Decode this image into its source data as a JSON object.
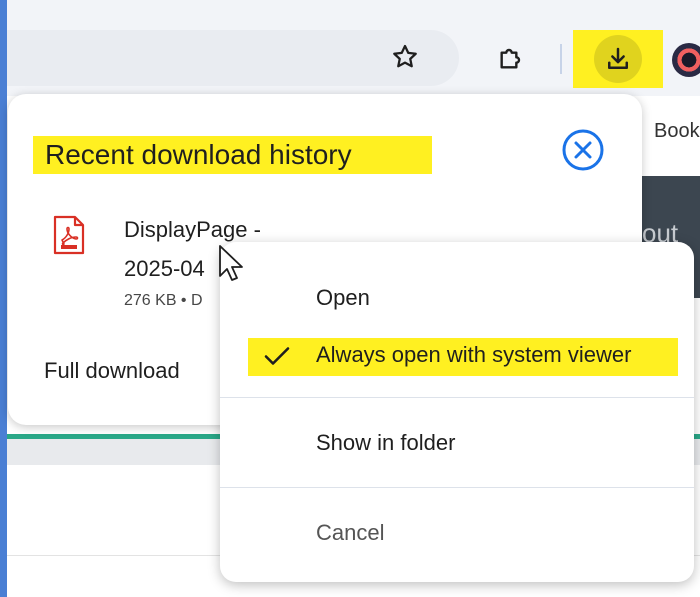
{
  "toolbar": {
    "bookmark_icon": "star-icon",
    "extensions_icon": "puzzle-icon",
    "downloads_icon": "download-icon",
    "profile_icon": "avatar"
  },
  "background_page": {
    "bookmarks_fragment": "Book",
    "dark_banner_fragment": "out"
  },
  "downloads_bubble": {
    "title": "Recent download history",
    "close_icon": "close-circle-icon",
    "item": {
      "file_icon": "pdf-icon",
      "name": "DisplayPage -\n2025-04",
      "meta": "276 KB • D"
    },
    "full_link": "Full download"
  },
  "context_menu": {
    "items": [
      {
        "label": "Open"
      },
      {
        "label": "Always open with system viewer",
        "checked": true
      },
      {
        "label": "Show in folder"
      },
      {
        "label": "Cancel"
      }
    ]
  },
  "colors": {
    "highlight": "#fff021",
    "accent": "#1a73e8",
    "pdf_red": "#d93025"
  }
}
